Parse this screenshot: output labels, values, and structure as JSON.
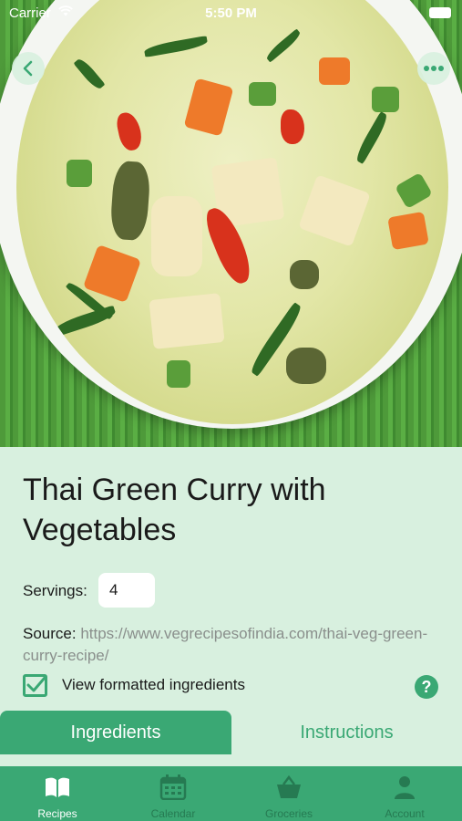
{
  "status_bar": {
    "carrier": "Carrier",
    "time": "5:50 PM"
  },
  "recipe": {
    "title": "Thai Green Curry with Vegetables",
    "servings_label": "Servings:",
    "servings_value": "4",
    "source_label": "Source:",
    "source_url": "https://www.vegrecipesofindia.com/thai-veg-green-curry-recipe/",
    "formatted_ingredients_label": "View formatted ingredients",
    "formatted_ingredients_checked": true,
    "help_symbol": "?"
  },
  "tabs": [
    {
      "label": "Ingredients",
      "selected": true
    },
    {
      "label": "Instructions",
      "selected": false
    }
  ],
  "tabbar": [
    {
      "label": "Recipes",
      "icon": "book-icon",
      "active": true
    },
    {
      "label": "Calendar",
      "icon": "calendar-icon",
      "active": false
    },
    {
      "label": "Groceries",
      "icon": "basket-icon",
      "active": false
    },
    {
      "label": "Account",
      "icon": "person-icon",
      "active": false
    }
  ],
  "colors": {
    "accent": "#3aa874",
    "background": "#d8f0df"
  }
}
